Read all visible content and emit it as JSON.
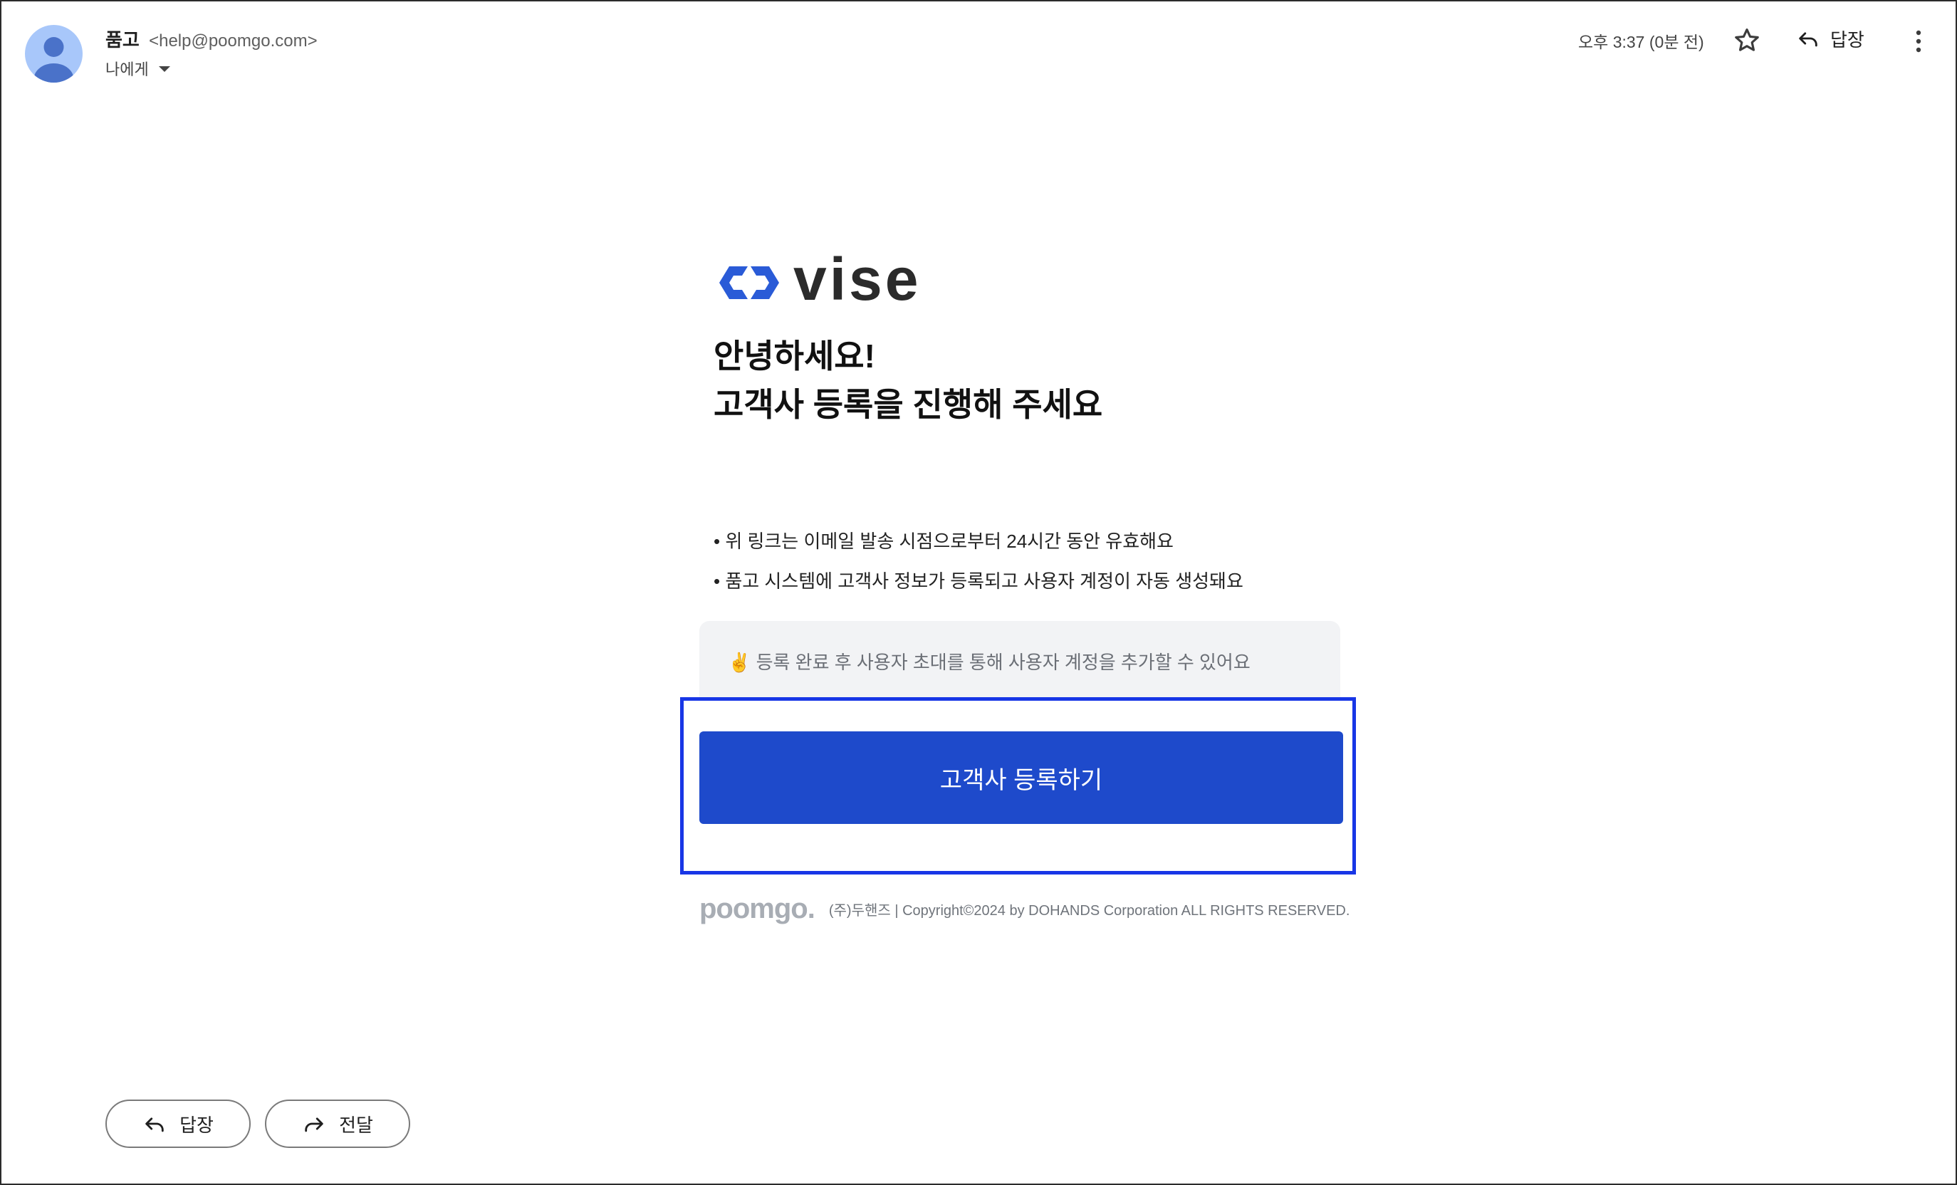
{
  "header": {
    "sender_name": "품고",
    "sender_email": "<help@poomgo.com>",
    "recipient": "나에게",
    "time": "오후 3:37 (0분 전)",
    "reply_label": "답장",
    "icons": [
      "avatar-icon",
      "chevron-down-icon",
      "star-icon",
      "reply-icon",
      "more-vert-icon"
    ]
  },
  "email": {
    "logo_text": "vise",
    "brand_color": "#2a5bd7",
    "heading_line1": "안녕하세요!",
    "heading_line2": "고객사 등록을 진행해 주세요",
    "bullets": [
      "• 위 링크는 이메일 발송 시점으로부터 24시간 동안 유효해요",
      "• 품고 시스템에 고객사 정보가 등록되고 사용자 계정이 자동 생성돼요"
    ],
    "note_emoji": "✌️",
    "note_text": "등록 완료 후 사용자 초대를 통해 사용자 계정을 추가할 수 있어요",
    "cta_label": "고객사 등록하기",
    "cta_color": "#1e4acb",
    "footer_logo": "poomgo.",
    "footer_copyright": "(주)두핸즈 | Copyright©2024 by DOHANDS Corporation ALL RIGHTS RESERVED."
  },
  "actions": {
    "reply_label": "답장",
    "forward_label": "전달"
  },
  "highlight_color": "#1836e6"
}
